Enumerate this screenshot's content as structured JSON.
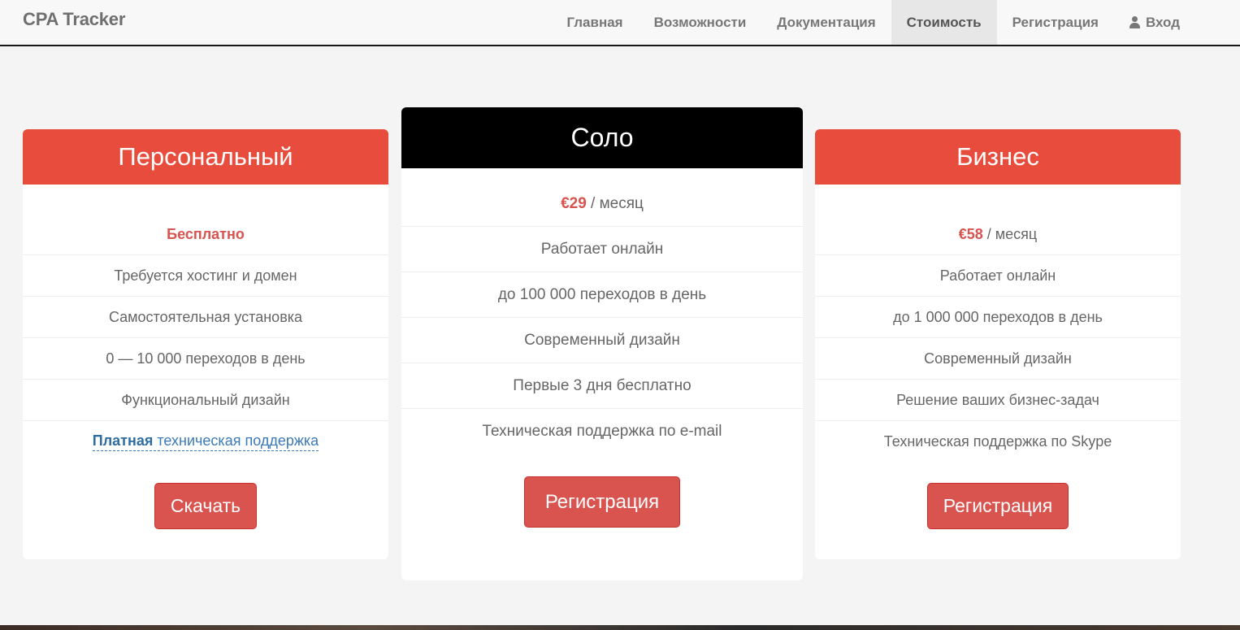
{
  "brand": "CPA Tracker",
  "nav": {
    "items": [
      "Главная",
      "Возможности",
      "Документация",
      "Стоимость",
      "Регистрация"
    ],
    "active": "Стоимость",
    "login": "Вход"
  },
  "plans": {
    "personal": {
      "title": "Персональный",
      "price": "Бесплатно",
      "features": [
        "Требуется хостинг и домен",
        "Самостоятельная установка",
        "0 — 10 000 переходов в день",
        "Функциональный дизайн"
      ],
      "support_bold": "Платная",
      "support_rest": " техническая поддержка",
      "button": "Скачать"
    },
    "solo": {
      "title": "Соло",
      "price": "€29",
      "period": " / месяц",
      "features": [
        "Работает онлайн",
        "до 100 000 переходов в день",
        "Современный дизайн",
        "Первые 3 дня бесплатно",
        "Техническая поддержка по e-mail"
      ],
      "button": "Регистрация"
    },
    "business": {
      "title": "Бизнес",
      "price": "€58",
      "period": " / месяц",
      "features": [
        "Работает онлайн",
        "до 1 000 000 переходов в день",
        "Современный дизайн",
        "Решение ваших бизнес-задач",
        "Техническая поддержка по Skype"
      ],
      "button": "Регистрация"
    }
  },
  "colors": {
    "accent_red": "#e74c3c",
    "button_red": "#d9534f",
    "link_blue": "#3a7ab8"
  }
}
